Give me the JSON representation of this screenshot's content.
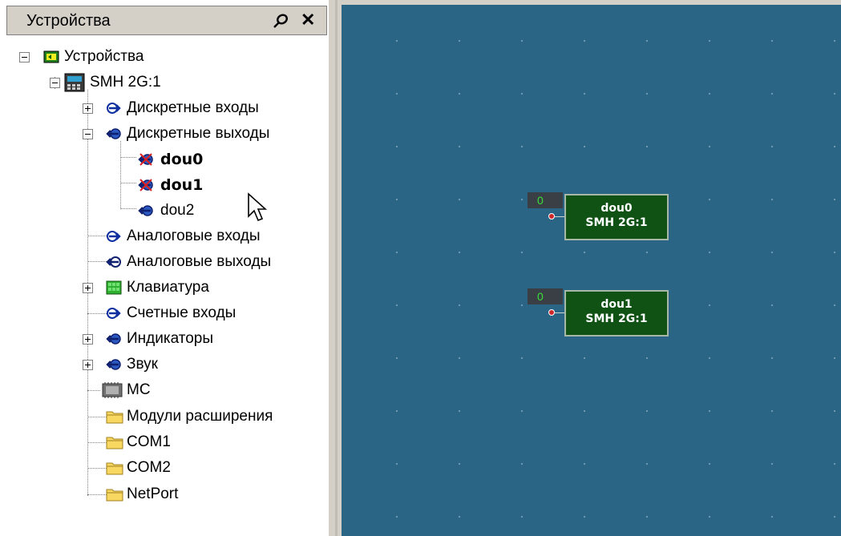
{
  "panel": {
    "title": "Устройства"
  },
  "tree": {
    "root": "Устройства",
    "device": "SMH 2G:1",
    "discrete_inputs": "Дискретные входы",
    "discrete_outputs": "Дискретные выходы",
    "dou0": "dou0",
    "dou1": "dou1",
    "dou2": "dou2",
    "analog_inputs": "Аналоговые входы",
    "analog_outputs": "Аналоговые выходы",
    "keyboard": "Клавиатура",
    "counter_inputs": "Счетные входы",
    "indicators": "Индикаторы",
    "sound": "Звук",
    "mc": "MC",
    "expansion_modules": "Модули расширения",
    "com1": "COM1",
    "com2": "COM2",
    "netport": "NetPort"
  },
  "canvas": {
    "blocks": [
      {
        "name": "dou0",
        "device": "SMH 2G:1",
        "value": "0"
      },
      {
        "name": "dou1",
        "device": "SMH 2G:1",
        "value": "0"
      }
    ]
  },
  "colors": {
    "canvas_bg": "#2b6585",
    "block_bg": "#0f5214",
    "value_text": "#38e038",
    "port": "#d0282c"
  },
  "icons": {
    "pin": "pin-icon",
    "close": "close-icon",
    "folder": "folder-icon",
    "device": "device-icon",
    "keyboard": "keyboard-icon",
    "input": "input-arrow-icon",
    "output": "output-arrow-icon",
    "disabled_output": "disabled-output-icon"
  }
}
